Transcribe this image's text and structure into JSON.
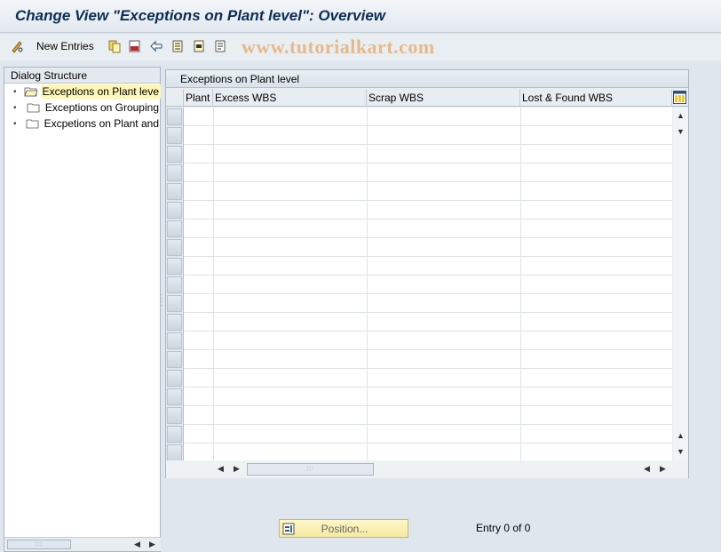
{
  "title": "Change View \"Exceptions on Plant level\": Overview",
  "toolbar": {
    "new_entries_label": "New Entries",
    "watermark": "www.tutorialkart.com"
  },
  "dialog_structure": {
    "header": "Dialog Structure",
    "items": [
      {
        "label": "Exceptions on Plant leve",
        "selected": true
      },
      {
        "label": "Exceptions on Grouping",
        "selected": false
      },
      {
        "label": "Excpetions on Plant and",
        "selected": false
      }
    ]
  },
  "table": {
    "title": "Exceptions on Plant level",
    "columns": [
      "Plant",
      "Excess WBS",
      "Scrap WBS",
      "Lost & Found WBS"
    ],
    "rows": []
  },
  "footer": {
    "position_button_label": "Position...",
    "entry_info": "Entry 0 of 0"
  },
  "colors": {
    "title_text": "#0b2d55",
    "selected_item_bg": "#fdf6b4",
    "position_button_bg": "#f5e9a2",
    "watermark": "#e6b98a"
  }
}
